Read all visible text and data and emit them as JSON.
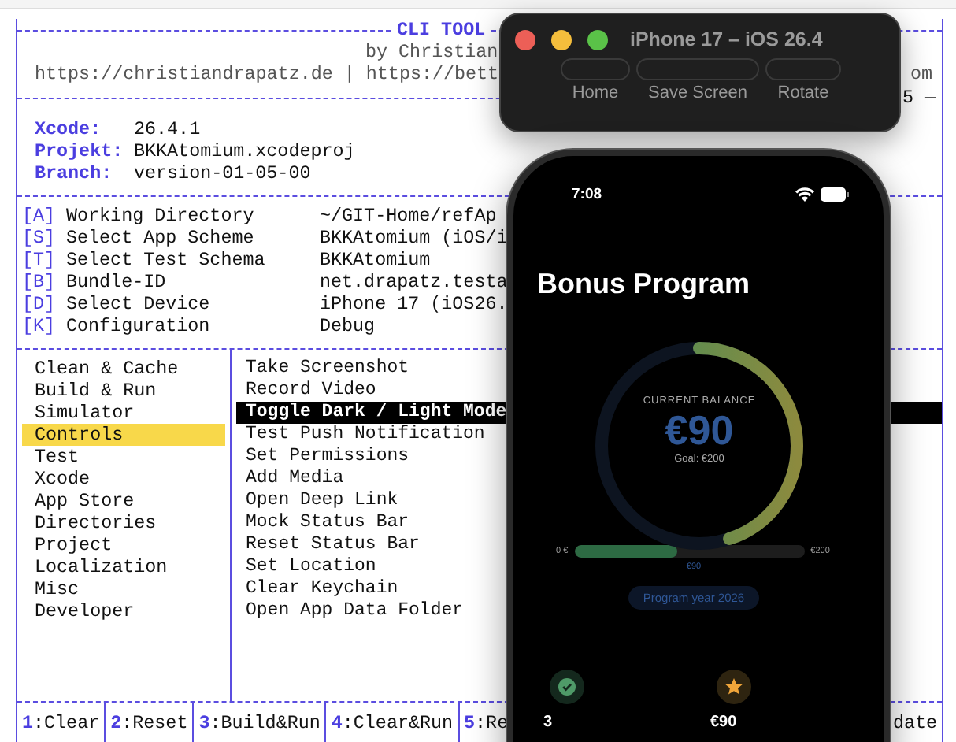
{
  "terminal": {
    "title": "CLI TOOL",
    "author": "by Christian",
    "links": "https://christiandrapatz.de | https://bett",
    "links_tail": "om",
    "separator_tail": "5 —",
    "info": [
      {
        "label": "Xcode:",
        "value": "26.4.1"
      },
      {
        "label": "Projekt:",
        "value": "BKKAtomium.xcodeproj"
      },
      {
        "label": "Branch:",
        "value": "version-01-05-00"
      }
    ],
    "settings": [
      {
        "key": "[A]",
        "label": "Working Directory",
        "value": "~/GIT-Home/refAp"
      },
      {
        "key": "[S]",
        "label": "Select App Scheme",
        "value": "BKKAtomium (iOS/i"
      },
      {
        "key": "[T]",
        "label": "Select Test Schema",
        "value": "BKKAtomium"
      },
      {
        "key": "[B]",
        "label": "Bundle-ID",
        "value": "net.drapatz.testa"
      },
      {
        "key": "[D]",
        "label": "Select Device",
        "value": "iPhone 17 (iOS26."
      },
      {
        "key": "[K]",
        "label": "Configuration",
        "value": "Debug"
      }
    ],
    "categories": [
      {
        "label": "Clean & Cache",
        "selected": false
      },
      {
        "label": "Build & Run",
        "selected": false
      },
      {
        "label": "Simulator",
        "selected": false
      },
      {
        "label": "Controls",
        "selected": true
      },
      {
        "label": "Test",
        "selected": false
      },
      {
        "label": "Xcode",
        "selected": false
      },
      {
        "label": "App Store",
        "selected": false
      },
      {
        "label": "Directories",
        "selected": false
      },
      {
        "label": "Project",
        "selected": false
      },
      {
        "label": "Localization",
        "selected": false
      },
      {
        "label": "Misc",
        "selected": false
      },
      {
        "label": "Developer",
        "selected": false
      }
    ],
    "actions": [
      {
        "label": "Take Screenshot",
        "selected": false
      },
      {
        "label": "Record Video",
        "selected": false
      },
      {
        "label": "Toggle Dark / Light Mode",
        "selected": true
      },
      {
        "label": "Test Push Notification",
        "selected": false
      },
      {
        "label": "Set Permissions",
        "selected": false
      },
      {
        "label": "Add Media",
        "selected": false
      },
      {
        "label": "Open Deep Link",
        "selected": false
      },
      {
        "label": "Mock Status Bar",
        "selected": false
      },
      {
        "label": "Reset Status Bar",
        "selected": false
      },
      {
        "label": "Set Location",
        "selected": false
      },
      {
        "label": "Clear Keychain",
        "selected": false
      },
      {
        "label": "Open App Data Folder",
        "selected": false
      }
    ],
    "shortcuts": [
      {
        "key": "1",
        "label": ":Clear"
      },
      {
        "key": "2",
        "label": ":Reset"
      },
      {
        "key": "3",
        "label": ":Build&Run"
      },
      {
        "key": "4",
        "label": ":Clear&Run"
      },
      {
        "key": "5",
        "label": ":Re"
      }
    ],
    "shortcuts_tail": "date"
  },
  "simulator": {
    "title": "iPhone 17 – iOS 26.4",
    "buttons": [
      "Home",
      "Save Screen",
      "Rotate"
    ]
  },
  "phone": {
    "time": "7:08",
    "title": "Bonus Program",
    "balance_label": "CURRENT BALANCE",
    "balance": "€90",
    "goal": "Goal: €200",
    "level": 0.45,
    "bar_min": "0 €",
    "bar_max": "€200",
    "bar_value": "€90",
    "pill": "Program year 2026",
    "stats": [
      {
        "kind": "check",
        "value": "3"
      },
      {
        "kind": "star",
        "value": "€90"
      }
    ]
  }
}
